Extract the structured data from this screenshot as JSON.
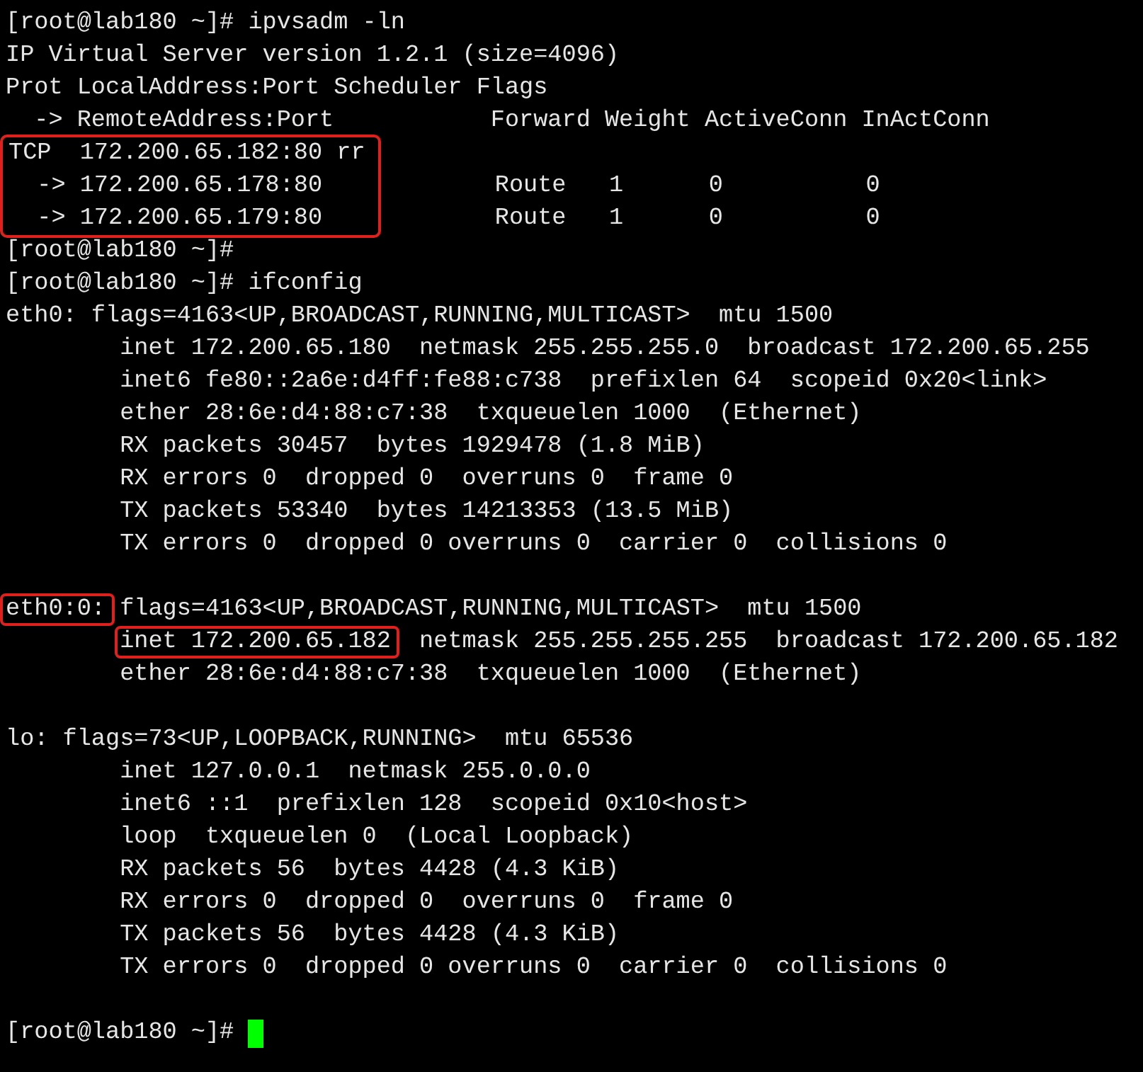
{
  "terminal": {
    "sections": [
      [
        "[root@lab180 ~]# ipvsadm -ln",
        "IP Virtual Server version 1.2.1 (size=4096)",
        "Prot LocalAddress:Port Scheduler Flags",
        "  -> RemoteAddress:Port           Forward Weight ActiveConn InActConn",
        {
          "kind": "split",
          "boxed": true,
          "left": [
            "TCP  172.200.65.182:80 rr",
            "  -> 172.200.65.178:80",
            "  -> 172.200.65.179:80"
          ],
          "right": [
            "Route   1      0          0",
            "Route   1      0          0"
          ]
        },
        "[root@lab180 ~]#",
        "[root@lab180 ~]# ifconfig",
        "eth0: flags=4163<UP,BROADCAST,RUNNING,MULTICAST>  mtu 1500",
        "        inet 172.200.65.180  netmask 255.255.255.0  broadcast 172.200.65.255",
        "        inet6 fe80::2a6e:d4ff:fe88:c738  prefixlen 64  scopeid 0x20<link>",
        "        ether 28:6e:d4:88:c7:38  txqueuelen 1000  (Ethernet)",
        "        RX packets 30457  bytes 1929478 (1.8 MiB)",
        "        RX errors 0  dropped 0  overruns 0  frame 0",
        "        TX packets 53340  bytes 14213353 (13.5 MiB)",
        "        TX errors 0  dropped 0 overruns 0  carrier 0  collisions 0"
      ],
      [
        {
          "kind": "segments",
          "indented": false,
          "segments": [
            {
              "text": "eth0:0:",
              "boxed": true
            },
            {
              "text": " flags=4163<UP,BROADCAST,RUNNING,MULTICAST>  mtu 1500",
              "boxed": false
            }
          ]
        },
        {
          "kind": "segments",
          "indented": true,
          "segments": [
            {
              "text": "inet 172.200.65.182",
              "boxed": true
            },
            {
              "text": "  netmask 255.255.255.255  broadcast 172.200.65.182",
              "boxed": false
            }
          ]
        },
        "        ether 28:6e:d4:88:c7:38  txqueuelen 1000  (Ethernet)"
      ],
      [
        "lo: flags=73<UP,LOOPBACK,RUNNING>  mtu 65536",
        "        inet 127.0.0.1  netmask 255.0.0.0",
        "        inet6 ::1  prefixlen 128  scopeid 0x10<host>",
        "        loop  txqueuelen 0  (Local Loopback)",
        "        RX packets 56  bytes 4428 (4.3 KiB)",
        "        RX errors 0  dropped 0  overruns 0  frame 0",
        "        TX packets 56  bytes 4428 (4.3 KiB)",
        "        TX errors 0  dropped 0 overruns 0  carrier 0  collisions 0"
      ],
      [
        {
          "kind": "prompt",
          "text": "[root@lab180 ~]#",
          "cursor": true
        }
      ]
    ]
  }
}
